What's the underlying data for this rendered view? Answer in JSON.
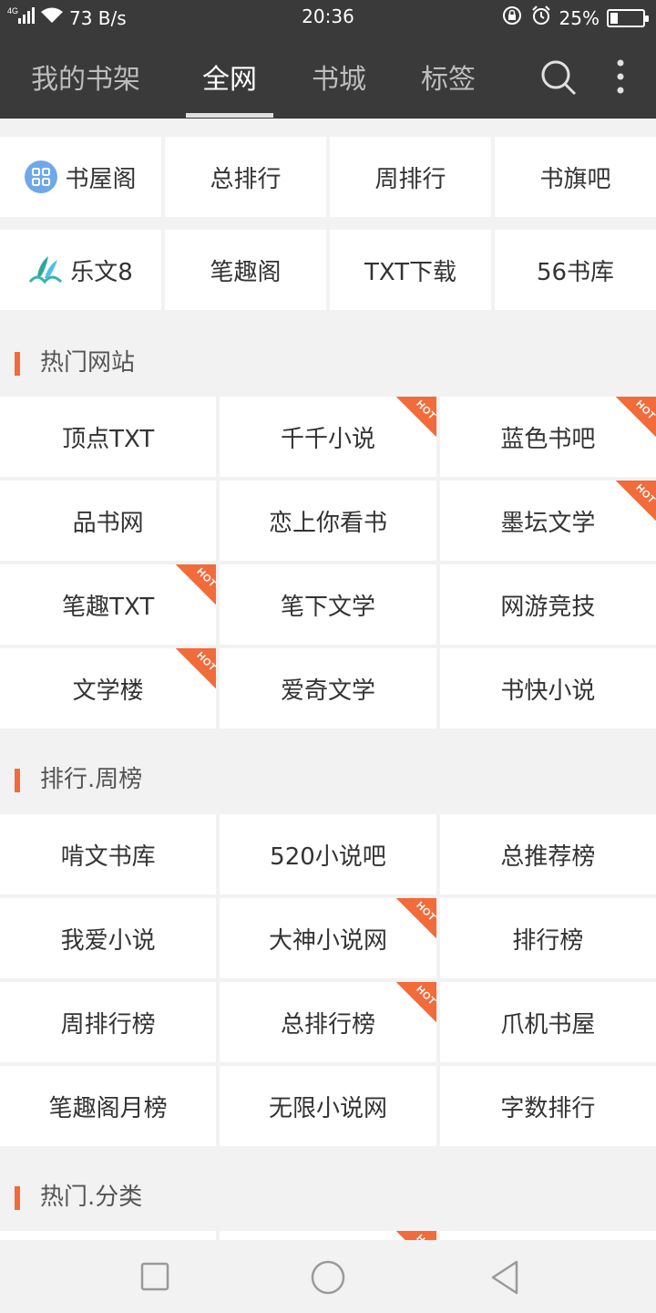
{
  "status_bar": {
    "network": "4G",
    "speed": "73 B/s",
    "time": "20:36",
    "battery": "25%"
  },
  "nav": {
    "tabs": [
      {
        "label": "我的书架",
        "active": false
      },
      {
        "label": "全网",
        "active": true
      },
      {
        "label": "书城",
        "active": false
      },
      {
        "label": "标签",
        "active": false
      }
    ],
    "icons": [
      "search-icon",
      "more-vertical-icon"
    ]
  },
  "quick_links": [
    {
      "label": "书屋阁",
      "icon": "grid-app-icon"
    },
    {
      "label": "总排行"
    },
    {
      "label": "周排行"
    },
    {
      "label": "书旗吧"
    },
    {
      "label": "乐文8",
      "icon": "book-leaf-icon"
    },
    {
      "label": "笔趣阁"
    },
    {
      "label": "TXT下载"
    },
    {
      "label": "56书库"
    }
  ],
  "sections": [
    {
      "title": "热门网站",
      "items": [
        {
          "label": "顶点TXT",
          "hot": false
        },
        {
          "label": "千千小说",
          "hot": true
        },
        {
          "label": "蓝色书吧",
          "hot": true
        },
        {
          "label": "品书网",
          "hot": false
        },
        {
          "label": "恋上你看书",
          "hot": false
        },
        {
          "label": "墨坛文学",
          "hot": true
        },
        {
          "label": "笔趣TXT",
          "hot": true
        },
        {
          "label": "笔下文学",
          "hot": false
        },
        {
          "label": "网游竞技",
          "hot": false
        },
        {
          "label": "文学楼",
          "hot": true
        },
        {
          "label": "爱奇文学",
          "hot": false
        },
        {
          "label": "书快小说",
          "hot": false
        }
      ]
    },
    {
      "title": "排行.周榜",
      "items": [
        {
          "label": "啃文书库",
          "hot": false
        },
        {
          "label": "520小说吧",
          "hot": false
        },
        {
          "label": "总推荐榜",
          "hot": false
        },
        {
          "label": "我爱小说",
          "hot": false
        },
        {
          "label": "大神小说网",
          "hot": true
        },
        {
          "label": "排行榜",
          "hot": false
        },
        {
          "label": "周排行榜",
          "hot": false
        },
        {
          "label": "总排行榜",
          "hot": true
        },
        {
          "label": "爪机书屋",
          "hot": false
        },
        {
          "label": "笔趣阁月榜",
          "hot": false
        },
        {
          "label": "无限小说网",
          "hot": false
        },
        {
          "label": "字数排行",
          "hot": false
        }
      ]
    },
    {
      "title": "热门.分类",
      "items": [
        {
          "label": "",
          "hot": false
        },
        {
          "label": "",
          "hot": true
        },
        {
          "label": "",
          "hot": false
        }
      ]
    }
  ],
  "hot_badge": "HOT",
  "colors": {
    "header_bg": "#3a3a3a",
    "accent": "#f26b3a",
    "page_bg": "#f2f2f2"
  },
  "bottom_nav": [
    "recent-apps-icon",
    "home-icon",
    "back-icon"
  ]
}
